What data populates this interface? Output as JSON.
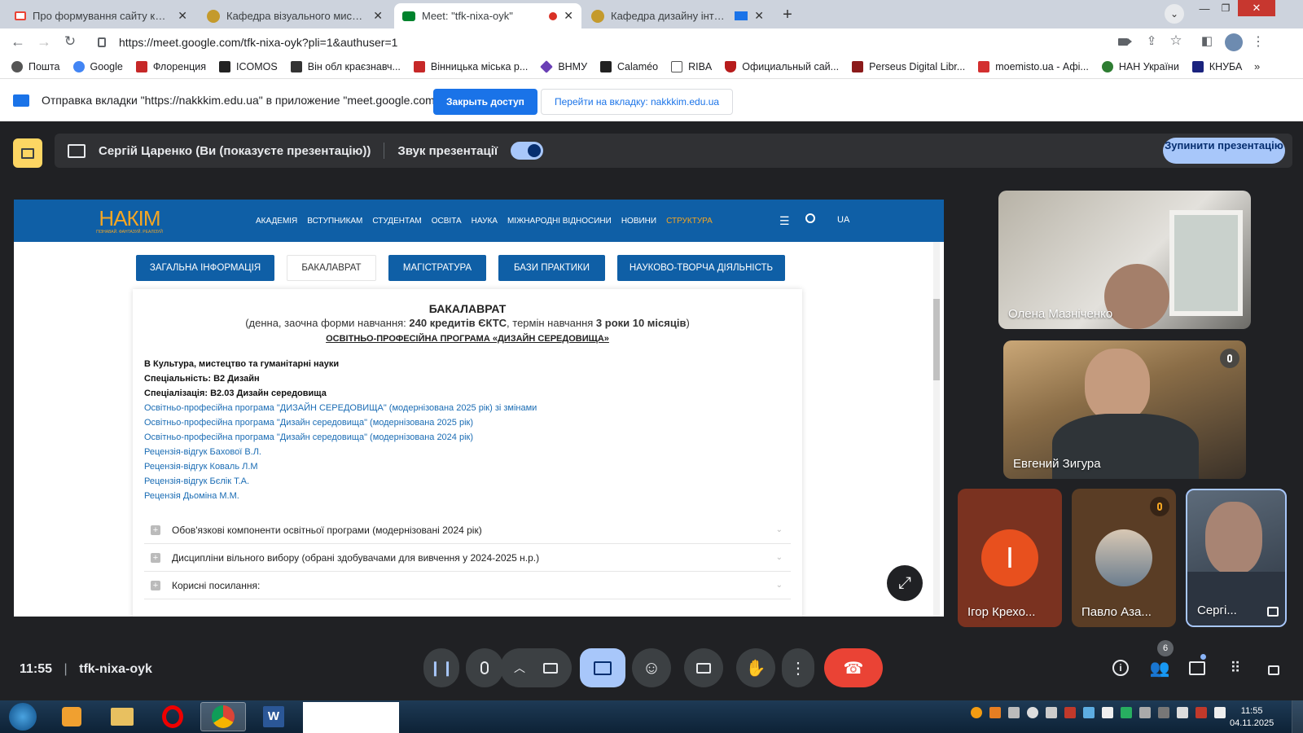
{
  "browser": {
    "tabs": [
      {
        "title": "Про формування сайту кафедр",
        "favicon": "gmail-icon",
        "color": "#ea4335"
      },
      {
        "title": "Кафедра візуального мистецтв",
        "favicon": "university-seal-icon",
        "color": "#c49a2c"
      },
      {
        "title": "Meet: \"tfk-nixa-oyk\"",
        "favicon": "meet-icon",
        "color": "#00832d",
        "active": true
      },
      {
        "title": "Кафедра дизайну інтер'єру",
        "favicon": "university-seal-icon",
        "color": "#c49a2c"
      }
    ],
    "url": "https://meet.google.com/tfk-nixa-oyk?pli=1&authuser=1",
    "bookmarks": [
      {
        "label": "Пошта",
        "color": "#555"
      },
      {
        "label": "Google",
        "color": "#4285f4"
      },
      {
        "label": "Флоренция",
        "color": "#c62828"
      },
      {
        "label": "ICOMOS",
        "color": "#222"
      },
      {
        "label": "Він обл краєзнавч...",
        "color": "#333"
      },
      {
        "label": "Вінницька міська р...",
        "color": "#c62828"
      },
      {
        "label": "ВНМУ",
        "color": "#6a3fb5"
      },
      {
        "label": "Calaméo",
        "color": "#222"
      },
      {
        "label": "RIBA",
        "color": "#555"
      },
      {
        "label": "Официальный сай...",
        "color": "#b71c1c"
      },
      {
        "label": "Perseus Digital Libr...",
        "color": "#8b1a1a"
      },
      {
        "label": "moemisto.ua - Афі...",
        "color": "#d32f2f"
      },
      {
        "label": "НАН України",
        "color": "#2e7d32"
      },
      {
        "label": "КНУБА",
        "color": "#1a237e"
      }
    ],
    "share_notice": {
      "text": "Отправка вкладки \"https://nakkkim.edu.ua\" в приложение \"meet.google.com\"...",
      "stop_label": "Закрыть доступ",
      "goto_label": "Перейти на вкладку: nakkkim.edu.ua"
    }
  },
  "meet": {
    "presenting_text": "Сергій Царенко (Ви (показуєте презентацію))",
    "audio_label": "Звук презентації",
    "stop_label": "Зупинити презентацію",
    "meeting_time": "11:55",
    "meeting_code": "tfk-nixa-oyk",
    "participant_count": "6",
    "participants": [
      {
        "name": "Олена Мазніченко"
      },
      {
        "name": "Евгений Зигура"
      },
      {
        "name": "Ігор Крехо...",
        "initial": "І"
      },
      {
        "name": "Павло Аза..."
      },
      {
        "name": "Сергі..."
      }
    ]
  },
  "site": {
    "logo": "НАКІМ",
    "logo_tagline": "ПІЗНАВАЙ. ФАНТАЗУЙ. РЕАЛІЗУЙ",
    "nav": [
      "АКАДЕМІЯ",
      "ВСТУПНИКАМ",
      "СТУДЕНТАМ",
      "ОСВІТА",
      "НАУКА",
      "МІЖНАРОДНІ ВІДНОСИНИ",
      "НОВИНИ",
      "СТРУКТУРА"
    ],
    "lang": "UA",
    "pills": [
      "ЗАГАЛЬНА ІНФОРМАЦІЯ",
      "БАКАЛАВРАТ",
      "МАГІСТРАТУРА",
      "БАЗИ ПРАКТИКИ",
      "НАУКОВО-ТВОРЧА ДІЯЛЬНІСТЬ"
    ],
    "card": {
      "heading": "БАКАЛАВРАТ",
      "sub_a": "(денна, заочна форми навчання: ",
      "sub_b": "240 кредитів ЄКТС",
      "sub_c": ", термін навчання ",
      "sub_d": "3 роки 10 місяців",
      "sub_e": ")",
      "program": "ОСВІТНЬО-ПРОФЕСІЙНА ПРОГРАМА «ДИЗАЙН СЕРЕДОВИЩА»",
      "bold_lines": [
        "В Культура, мистецтво та гуманітарні науки",
        "Спеціальність: В2 Дизайн",
        "Спеціалізація: В2.03 Дизайн середовища"
      ],
      "links": [
        "Освітньо-професійна програма \"ДИЗАЙН СЕРЕДОВИЩА\" (модернізована 2025 рік) зі змінами",
        "Освітньо-професійна програма \"Дизайн середовища\" (модернізована 2025 рік)",
        "Освітньо-професійна програма \"Дизайн середовища\" (модернізована 2024 рік)",
        "Рецензія-відгук Бахової В.Л.",
        "Рецензія-відгук Коваль Л.М",
        "Рецензія-відгук Бєлік Т.А.",
        "Рецензія Дьоміна М.М."
      ],
      "accordion": [
        "Обов'язкові компоненти освітньої програми (модернізовані 2024 рік)",
        "Дисципліни вільного вибору (обрані здобувачами для вивчення у 2024-2025 н.р.)",
        "Корисні посилання:"
      ]
    }
  },
  "taskbar": {
    "time": "11:55",
    "date": "04.11.2025"
  },
  "colors": {
    "site_blue": "#0f5fa6",
    "meet_bg": "#202124",
    "leave_red": "#ea4335",
    "accent_light_blue": "#a8c7fa"
  }
}
